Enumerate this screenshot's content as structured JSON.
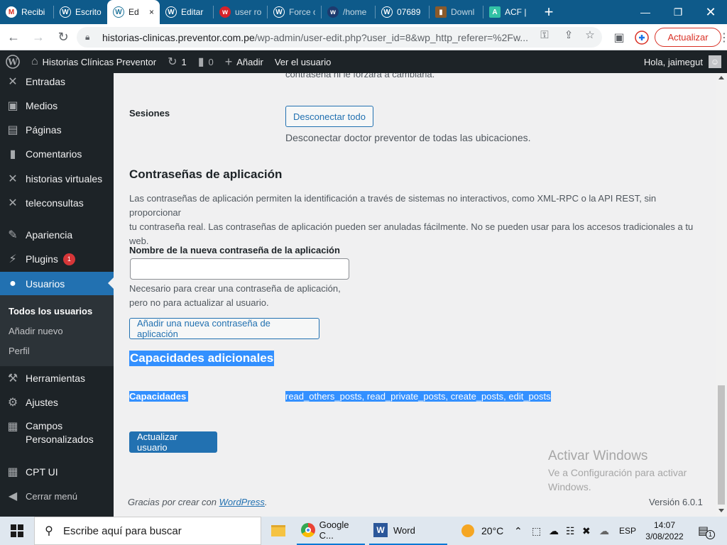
{
  "browser": {
    "tabs": [
      {
        "title": "Recibi",
        "favicon": "gmail-icon",
        "color": "#d93025"
      },
      {
        "title": "Escrito",
        "favicon": "wordpress-icon",
        "color": "#ffffff"
      },
      {
        "title": "Ed",
        "favicon": "wordpress-icon",
        "color": "#21759b",
        "active": true
      },
      {
        "title": "Editar",
        "favicon": "wordpress-icon",
        "color": "#ffffff"
      },
      {
        "title": "user ro",
        "favicon": "w-red-icon",
        "color": "#d6222a"
      },
      {
        "title": "Force c",
        "favicon": "wordpress-icon",
        "color": "#ffffff"
      },
      {
        "title": "/home",
        "favicon": "w-blue-icon",
        "color": "#1e3a6e"
      },
      {
        "title": "07689",
        "favicon": "wordpress-icon",
        "color": "#ffffff"
      },
      {
        "title": "Downl",
        "favicon": "book-icon",
        "color": "#8a5a2b"
      },
      {
        "title": "ACF |",
        "favicon": "acf-icon",
        "color": "#32c1a5"
      }
    ],
    "close_tab_glyph": "×",
    "new_tab_glyph": "+",
    "url_host": "historias-clinicas.preventor.com.pe",
    "url_path": "/wp-admin/user-edit.php?user_id=8&wp_http_referer=%2Fw...",
    "update_label": "Actualizar"
  },
  "adminbar": {
    "site_name": "Historias Clínicas Preventor",
    "updates_count": "1",
    "comments_count": "0",
    "add_new": "Añadir",
    "view_user": "Ver el usuario",
    "greeting": "Hola, jaimegut"
  },
  "sidebar": {
    "items": [
      {
        "label": "Entradas",
        "icon": "pin-icon"
      },
      {
        "label": "Medios",
        "icon": "media-icon"
      },
      {
        "label": "Páginas",
        "icon": "page-icon"
      },
      {
        "label": "Comentarios",
        "icon": "comment-icon"
      },
      {
        "label": "historias virtuales",
        "icon": "pin-icon"
      },
      {
        "label": "teleconsultas",
        "icon": "pin-icon"
      },
      {
        "label": "Apariencia",
        "icon": "brush-icon"
      },
      {
        "label": "Plugins",
        "icon": "plugin-icon",
        "badge": "1"
      },
      {
        "label": "Usuarios",
        "icon": "user-icon",
        "current": true
      },
      {
        "label": "Herramientas",
        "icon": "wrench-icon"
      },
      {
        "label": "Ajustes",
        "icon": "settings-icon"
      },
      {
        "label": "Campos Personalizados",
        "icon": "table-icon"
      },
      {
        "label": "CPT UI",
        "icon": "grid-icon"
      },
      {
        "label": "Cerrar menú",
        "icon": "collapse-icon"
      }
    ],
    "submenu": [
      {
        "label": "Todos los usuarios",
        "current": true
      },
      {
        "label": "Añadir nuevo"
      },
      {
        "label": "Perfil"
      }
    ]
  },
  "main": {
    "cut_text": "contraseña ni le forzará a cambiarla.",
    "sessions_label": "Sesiones",
    "logout_all_button": "Desconectar todo",
    "logout_desc": "Desconectar doctor preventor de todas las ubicaciones.",
    "app_passwords_title": "Contraseñas de aplicación",
    "app_passwords_desc_1": "Las contraseñas de aplicación permiten la identificación a través de sistemas no interactivos, como XML-RPC o la API REST, sin proporcionar",
    "app_passwords_desc_2": "tu contraseña real. Las contraseñas de aplicación pueden ser anuladas fácilmente. No se pueden usar para los accesos tradicionales a tu",
    "app_passwords_desc_3": "web.",
    "new_app_password_label": "Nombre de la nueva contraseña de la aplicación",
    "new_app_password_value": "",
    "new_app_password_help_1": "Necesario para crear una contraseña de aplicación,",
    "new_app_password_help_2": "pero no para actualizar al usuario.",
    "add_app_password_button": "Añadir una nueva contraseña de aplicación",
    "extra_caps_title": "Capacidades adicionales",
    "caps_label": "Capacidades",
    "caps_value": "read_others_posts, read_private_posts, create_posts, edit_posts",
    "update_user_button": "Actualizar usuario",
    "footer_prefix": "Gracias por crear con ",
    "footer_link": "WordPress",
    "footer_suffix": ".",
    "version": "Versión 6.0.1",
    "activate_title": "Activar Windows",
    "activate_line1": "Ve a Configuración para activar",
    "activate_line2": "Windows."
  },
  "taskbar": {
    "search_placeholder": "Escribe aquí para buscar",
    "apps": [
      {
        "label": "",
        "icon": "file-explorer-icon"
      },
      {
        "label": "Google C...",
        "icon": "chrome-icon"
      },
      {
        "label": "Word",
        "icon": "word-icon"
      }
    ],
    "weather": "20°C",
    "language": "ESP",
    "time": "14:07",
    "date": "3/08/2022",
    "notifications": "1"
  }
}
